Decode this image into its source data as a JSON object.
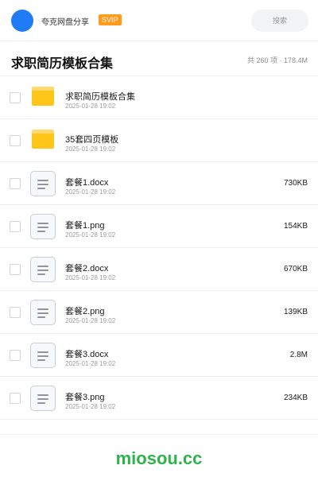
{
  "header": {
    "uploader": "夸克网盘分享",
    "badge": "SVIP",
    "search_label": "搜索"
  },
  "page": {
    "title": "求职简历模板合集",
    "summary": "共 260 项 · 178.4M"
  },
  "items": [
    {
      "type": "folder",
      "icon": "folder-icon",
      "name": "求职简历模板合集",
      "date": "2025-01-28 19:02",
      "size": ""
    },
    {
      "type": "folder",
      "icon": "folder-icon",
      "name": "35套四页模板",
      "date": "2025-01-28 19:02",
      "size": ""
    },
    {
      "type": "file",
      "icon": "document-icon",
      "name": "套餐1.docx",
      "date": "2025-01-28 19:02",
      "size": "730KB"
    },
    {
      "type": "file",
      "icon": "document-icon",
      "name": "套餐1.png",
      "date": "2025-01-28 19:02",
      "size": "154KB"
    },
    {
      "type": "file",
      "icon": "document-icon",
      "name": "套餐2.docx",
      "date": "2025-01-28 19:02",
      "size": "670KB"
    },
    {
      "type": "file",
      "icon": "document-icon",
      "name": "套餐2.png",
      "date": "2025-01-28 19:02",
      "size": "139KB"
    },
    {
      "type": "file",
      "icon": "document-icon",
      "name": "套餐3.docx",
      "date": "2025-01-28 19:02",
      "size": "2.8M"
    },
    {
      "type": "file",
      "icon": "document-icon",
      "name": "套餐3.png",
      "date": "2025-01-28 19:02",
      "size": "234KB"
    }
  ],
  "watermark": "miosou.cc",
  "colors": {
    "avatar": "#1f7cf5",
    "badge": "#ff9a1a",
    "folder": "#ffc61a",
    "watermark": "#2db34a"
  }
}
